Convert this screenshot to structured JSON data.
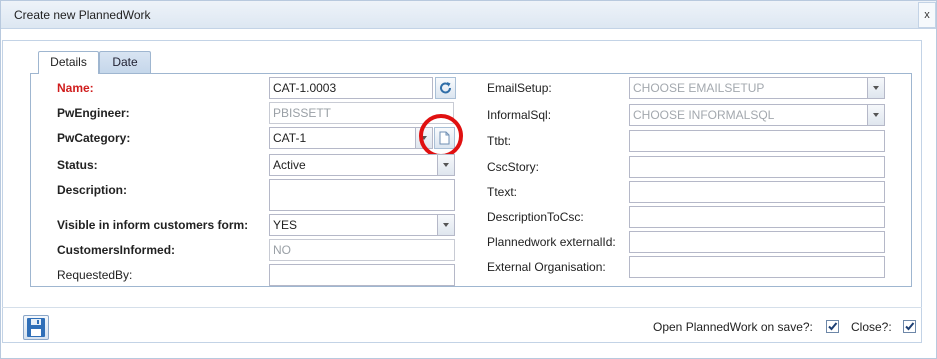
{
  "window": {
    "title": "Create new PlannedWork",
    "close_label": "x"
  },
  "tabs": [
    {
      "label": "Details",
      "active": true
    },
    {
      "label": "Date",
      "active": false
    }
  ],
  "left_fields": {
    "name": {
      "label": "Name:",
      "value": "CAT-1.0003"
    },
    "pw_engineer": {
      "label": "PwEngineer:",
      "value": "PBISSETT"
    },
    "pw_category": {
      "label": "PwCategory:",
      "value": "CAT-1"
    },
    "status": {
      "label": "Status:",
      "value": "Active"
    },
    "description": {
      "label": "Description:",
      "value": ""
    },
    "visible_inform": {
      "label": "Visible in inform customers form:",
      "value": "YES"
    },
    "customers_informed": {
      "label": "CustomersInformed:",
      "value": "NO"
    },
    "requested_by": {
      "label": "RequestedBy:",
      "value": ""
    }
  },
  "right_fields": {
    "email_setup": {
      "label": "EmailSetup:",
      "placeholder": "CHOOSE EMAILSETUP"
    },
    "informal_sql": {
      "label": "InformalSql:",
      "placeholder": "CHOOSE INFORMALSQL"
    },
    "ttbt": {
      "label": "Ttbt:",
      "value": ""
    },
    "csc_story": {
      "label": "CscStory:",
      "value": ""
    },
    "ttext": {
      "label": "Ttext:",
      "value": ""
    },
    "description_to_csc": {
      "label": "DescriptionToCsc:",
      "value": ""
    },
    "plannedwork_external_id": {
      "label": "Plannedwork externalId:",
      "value": ""
    },
    "external_organisation": {
      "label": "External Organisation:",
      "value": ""
    }
  },
  "footer": {
    "open_on_save_label": "Open PlannedWork on save?:",
    "open_on_save_checked": true,
    "close_label": "Close?:",
    "close_checked": true
  },
  "icons": {
    "refresh": "refresh-icon",
    "new_document": "document-icon",
    "save": "floppy-disk-icon",
    "dropdown": "chevron-down-icon",
    "check": "checkmark-icon"
  },
  "colors": {
    "required_label": "#d01d1d",
    "highlight_circle": "#e01010",
    "border": "#9fb6d0"
  }
}
